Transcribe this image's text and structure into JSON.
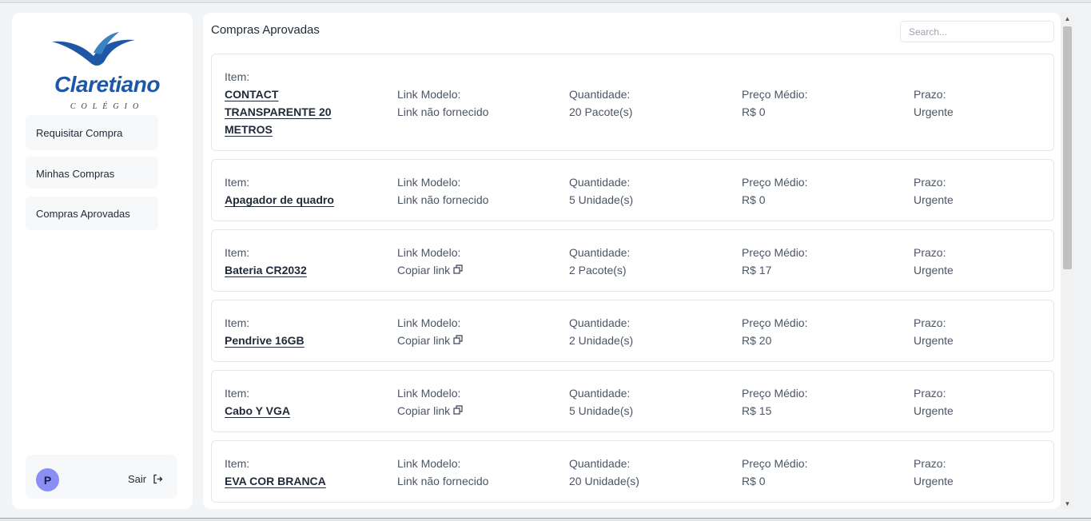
{
  "brand": {
    "name": "Claretiano",
    "sub": "COLÉGIO",
    "color": "#1e57a6"
  },
  "sidebar": {
    "items": [
      {
        "label": "Requisitar Compra"
      },
      {
        "label": "Minhas Compras"
      },
      {
        "label": "Compras Aprovadas"
      }
    ],
    "user": {
      "initial": "P",
      "logout_label": "Sair",
      "logout_icon": "logout-icon"
    }
  },
  "main": {
    "title": "Compras Aprovadas",
    "search": {
      "placeholder": "Search...",
      "value": ""
    },
    "labels": {
      "item": "Item:",
      "link": "Link Modelo:",
      "qty": "Quantidade:",
      "price": "Preço Médio:",
      "prazo": "Prazo:"
    },
    "copy_icon": "copy-icon",
    "rows": [
      {
        "item": "CONTACT TRANSPARENTE 20 METROS",
        "link": "Link não fornecido",
        "qty": "20 Pacote(s)",
        "price": "R$ 0",
        "prazo": "Urgente"
      },
      {
        "item": "Apagador de quadro",
        "link": "Link não fornecido",
        "qty": "5 Unidade(s)",
        "price": "R$ 0",
        "prazo": "Urgente"
      },
      {
        "item": "Bateria CR2032",
        "link": "Copiar link",
        "qty": "2 Pacote(s)",
        "price": "R$ 17",
        "prazo": "Urgente"
      },
      {
        "item": "Pendrive 16GB",
        "link": "Copiar link",
        "qty": "2 Unidade(s)",
        "price": "R$ 20",
        "prazo": "Urgente"
      },
      {
        "item": "Cabo Y VGA",
        "link": "Copiar link",
        "qty": "5 Unidade(s)",
        "price": "R$ 15",
        "prazo": "Urgente"
      },
      {
        "item": "EVA COR BRANCA",
        "link": "Link não fornecido",
        "qty": "20 Unidade(s)",
        "price": "R$ 0",
        "prazo": "Urgente"
      }
    ]
  }
}
